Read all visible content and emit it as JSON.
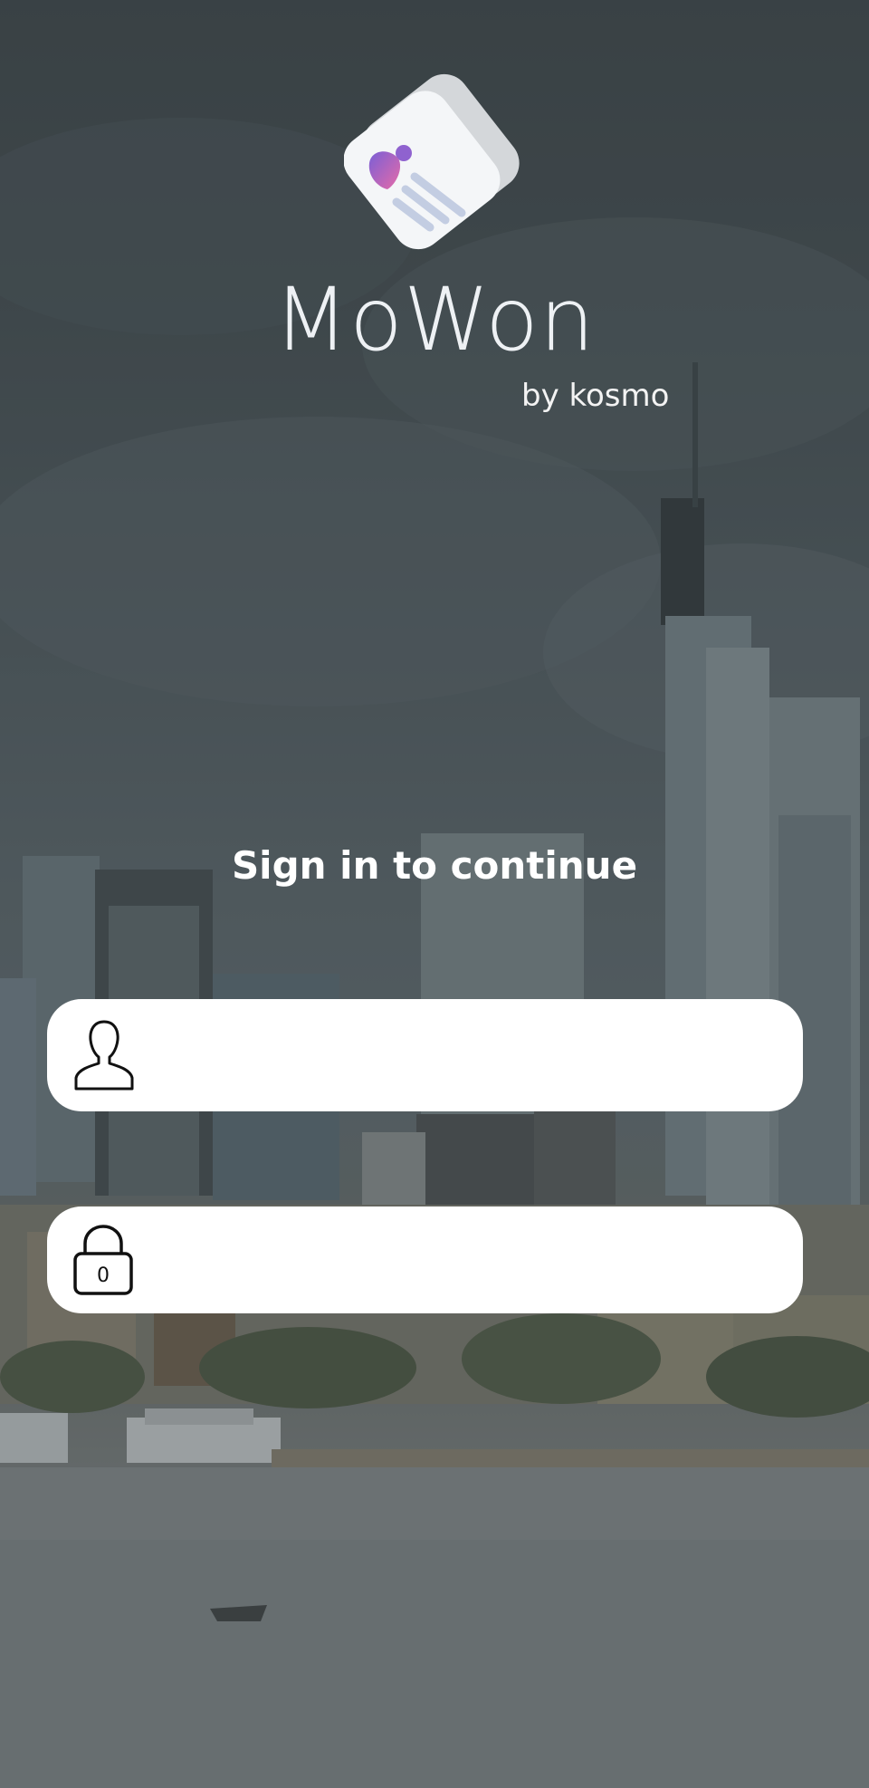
{
  "app": {
    "name": "MoWon",
    "byline": "by kosmo"
  },
  "login": {
    "heading": "Sign in to continue",
    "username_field": {
      "value": "",
      "placeholder": "",
      "icon": "user-icon"
    },
    "password_field": {
      "value": "",
      "placeholder": "",
      "icon": "lock-icon",
      "icon_glyph": "0"
    }
  },
  "colors": {
    "overlay": "#3b4347",
    "field_background": "#ffffff",
    "text": "#ffffff"
  }
}
